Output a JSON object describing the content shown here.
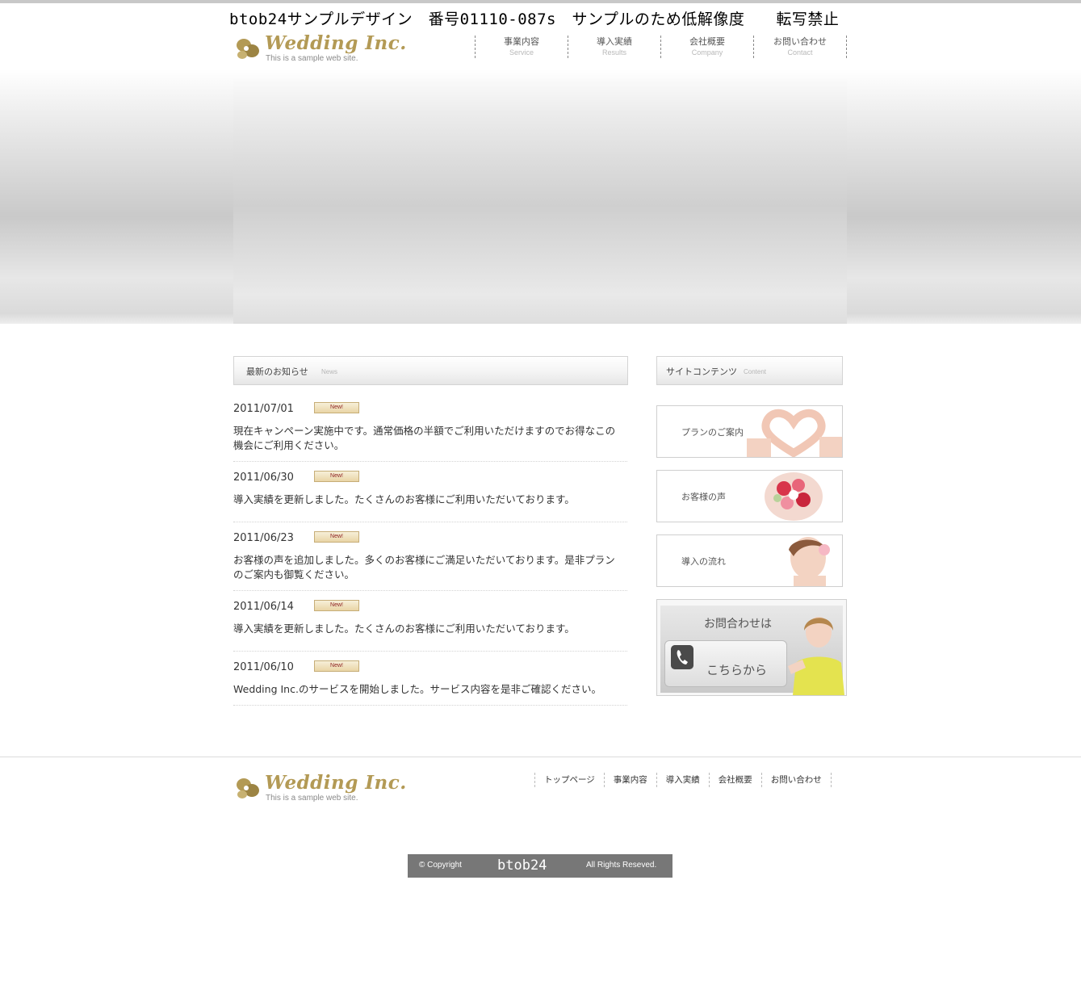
{
  "watermark": "btob24サンプルデザイン　番号01110-087s　サンプルのため低解像度　　転写禁止",
  "header": {
    "logo": {
      "brand": "Wedding Inc.",
      "tagline": "This is a sample web site."
    },
    "nav": [
      {
        "jp": "事業内容",
        "en": "Service"
      },
      {
        "jp": "導入実績",
        "en": "Results"
      },
      {
        "jp": "会社概要",
        "en": "Company"
      },
      {
        "jp": "お問い合わせ",
        "en": "Contact"
      }
    ]
  },
  "news": {
    "heading_jp": "最新のお知らせ",
    "heading_en": "News",
    "badge": "New!",
    "items": [
      {
        "date": "2011/07/01",
        "text": "現在キャンペーン実施中です。通常価格の半額でご利用いただけますのでお得なこの機会にご利用ください。"
      },
      {
        "date": "2011/06/30",
        "text": "導入実績を更新しました。たくさんのお客様にご利用いただいております。"
      },
      {
        "date": "2011/06/23",
        "text": "お客様の声を追加しました。多くのお客様にご満足いただいております。是非プランのご案内も御覧ください。"
      },
      {
        "date": "2011/06/14",
        "text": "導入実績を更新しました。たくさんのお客様にご利用いただいております。"
      },
      {
        "date": "2011/06/10",
        "text": "Wedding Inc.のサービスを開始しました。サービス内容を是非ご確認ください。"
      }
    ]
  },
  "sidebar": {
    "heading_jp": "サイトコンテンツ",
    "heading_en": "Content",
    "banners": [
      {
        "label": "プランのご案内",
        "icon": "heart-hands-photo"
      },
      {
        "label": "お客様の声",
        "icon": "bouquet-photo"
      },
      {
        "label": "導入の流れ",
        "icon": "bride-photo"
      }
    ],
    "contact": {
      "heading": "お問合わせは",
      "button": "こちらから",
      "icon": "phone-icon"
    }
  },
  "footer": {
    "logo": {
      "brand": "Wedding Inc.",
      "tagline": "This is a sample web site."
    },
    "nav": [
      "トップページ",
      "事業内容",
      "導入実績",
      "会社概要",
      "お問い合わせ"
    ],
    "copyright": {
      "prefix": "© Copyright",
      "name": "btob24",
      "suffix": "All Rights Reseved."
    }
  },
  "colors": {
    "brand_gold": "#b39a55",
    "copyright_bg": "#777777",
    "badge_red": "#8b1d1d"
  }
}
